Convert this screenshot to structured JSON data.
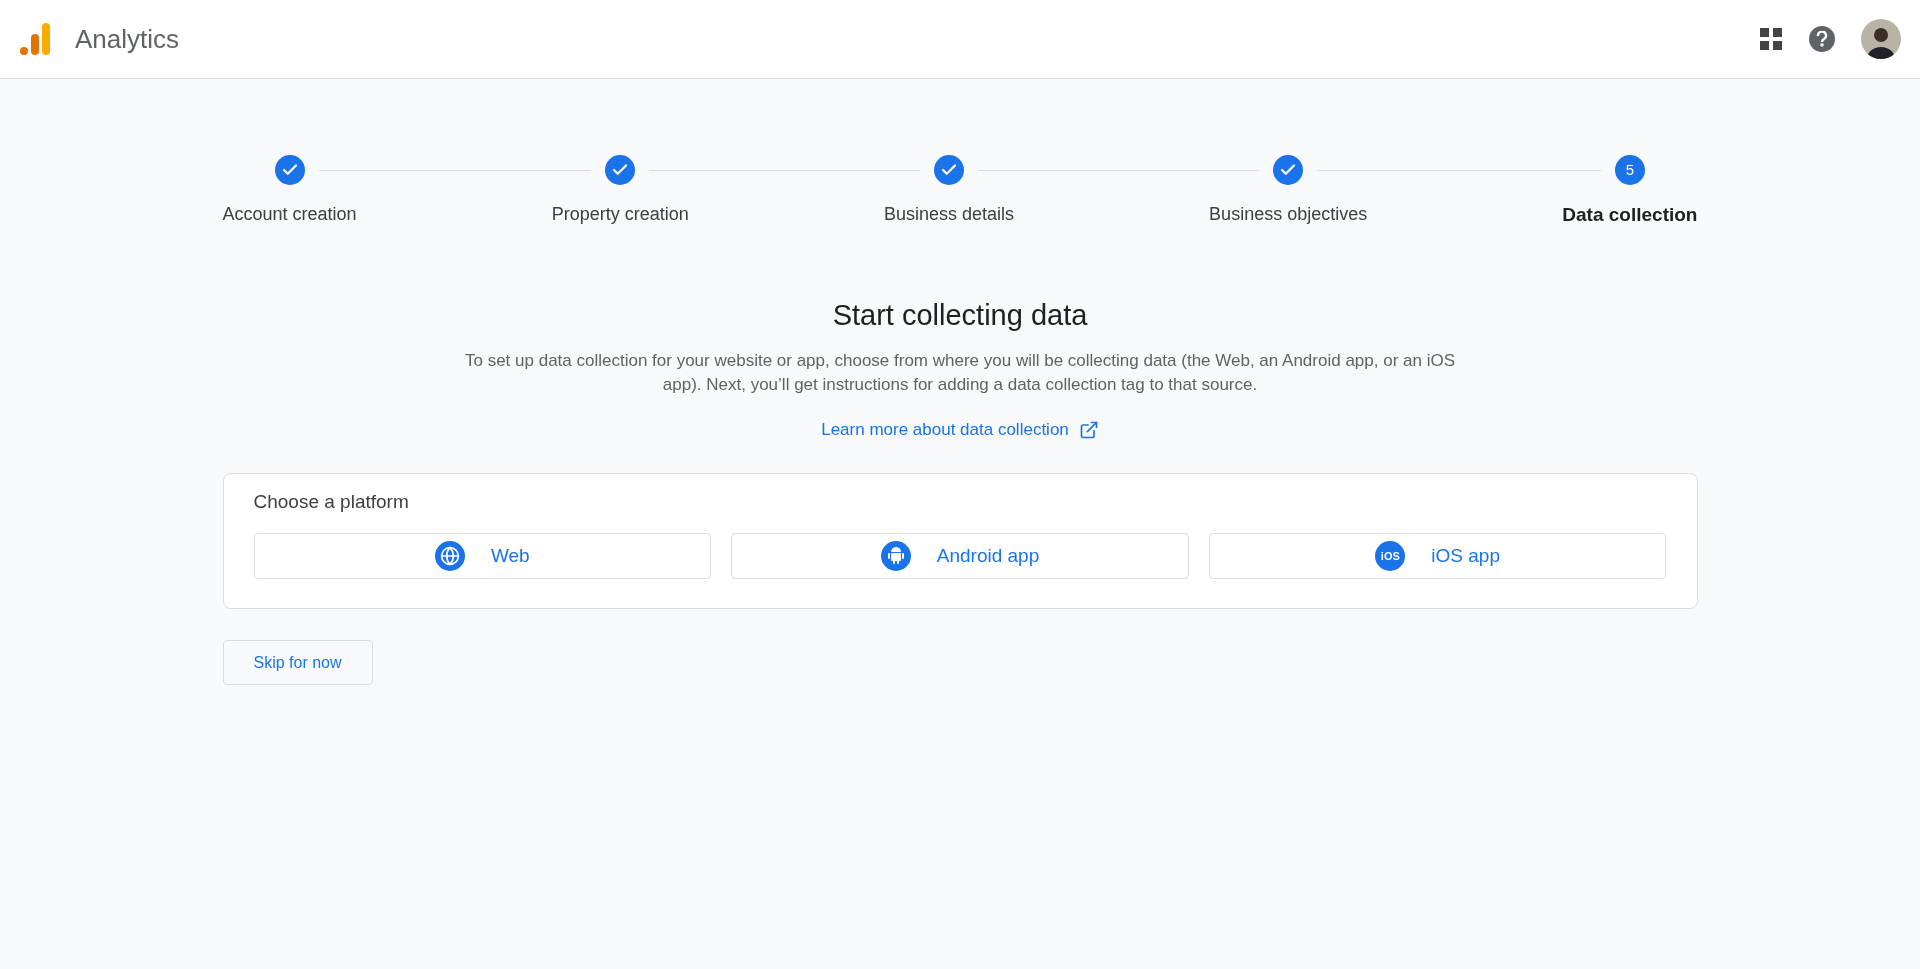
{
  "header": {
    "title": "Analytics"
  },
  "steps": [
    {
      "label": "Account creation",
      "completed": true,
      "current": false
    },
    {
      "label": "Property creation",
      "completed": true,
      "current": false
    },
    {
      "label": "Business details",
      "completed": true,
      "current": false
    },
    {
      "label": "Business objectives",
      "completed": true,
      "current": false
    },
    {
      "label": "Data collection",
      "completed": false,
      "current": true,
      "number": "5"
    }
  ],
  "intro": {
    "title": "Start collecting data",
    "description": "To set up data collection for your website or app, choose from where you will be collecting data (the Web, an Android app, or an iOS app). Next, you’ll get instructions for adding a data collection tag to that source.",
    "link": "Learn more about data collection"
  },
  "platform_card": {
    "title": "Choose a platform",
    "options": [
      {
        "kind": "web",
        "label": "Web"
      },
      {
        "kind": "android",
        "label": "Android app"
      },
      {
        "kind": "ios",
        "label": "iOS app",
        "icon_text": "iOS"
      }
    ]
  },
  "skip_button": "Skip for now"
}
